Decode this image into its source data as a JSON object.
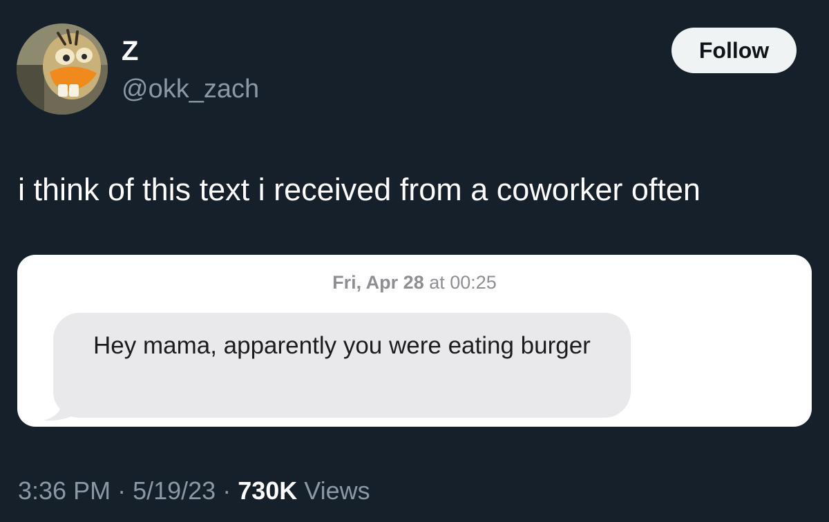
{
  "author": {
    "display_name": "Z",
    "handle": "@okk_zach"
  },
  "follow_button": {
    "label": "Follow"
  },
  "tweet": {
    "text": "i think of this text i received from a coworker often"
  },
  "message_screenshot": {
    "timestamp_day": "Fri, Apr 28",
    "timestamp_at": "at 00:25",
    "message_text": "Hey mama, apparently you were eating burger"
  },
  "meta": {
    "time": "3:36 PM",
    "separator": "·",
    "date": "5/19/23",
    "views_count": "730K",
    "views_label": "Views"
  },
  "colors": {
    "background": "#15202b",
    "secondary_text": "#8b98a5",
    "follow_bg": "#eff3f4",
    "bubble_gray": "#e9e9eb"
  }
}
